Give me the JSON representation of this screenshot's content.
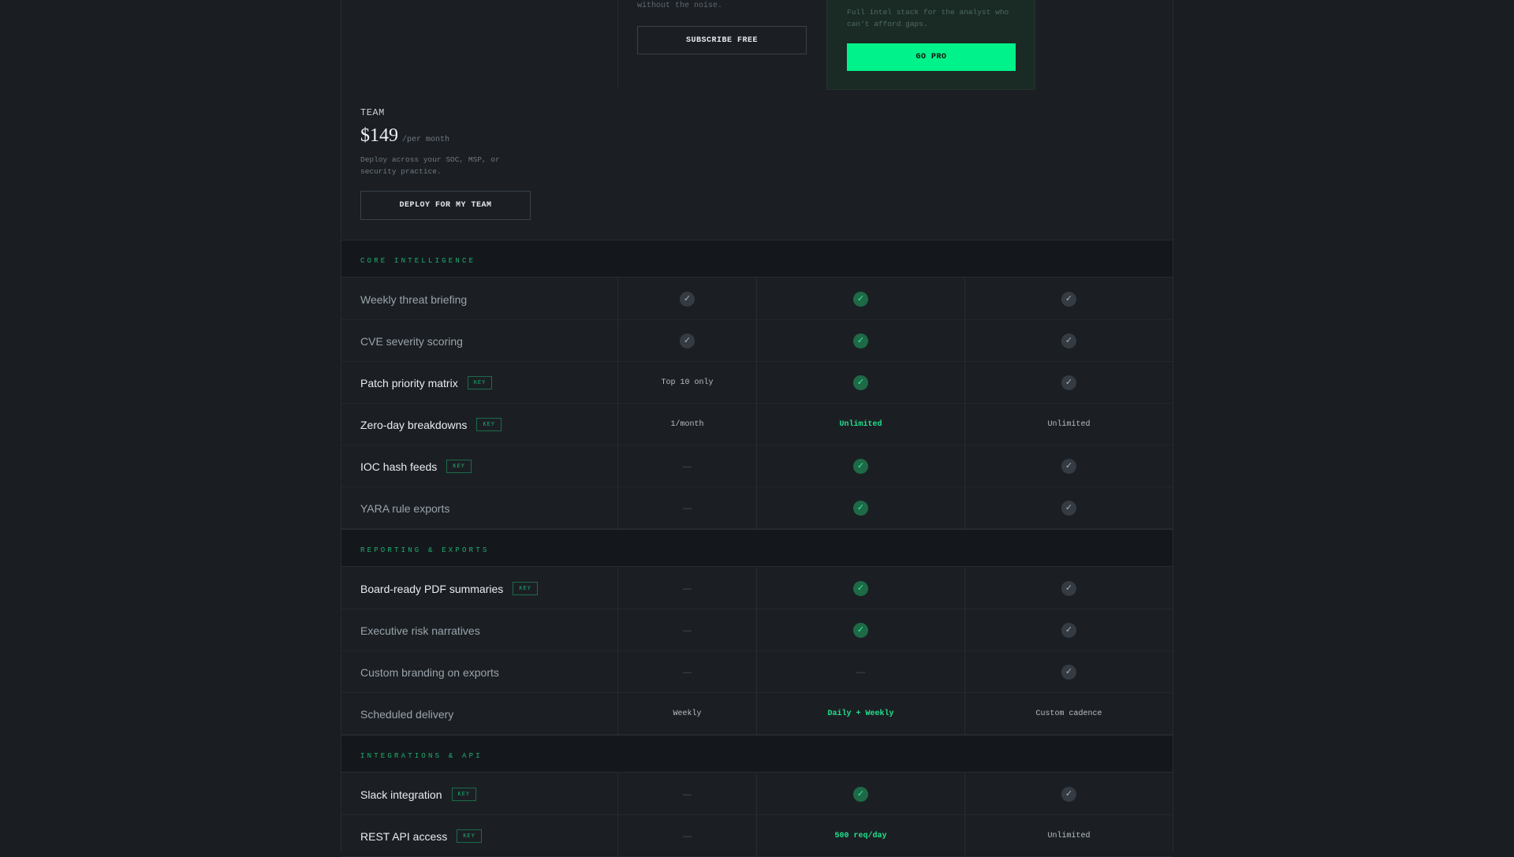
{
  "plans": {
    "free": {
      "desc_tail": "without the noise.",
      "button": "SUBSCRIBE FREE"
    },
    "pro": {
      "desc": "Full intel stack for the analyst who can't afford gaps.",
      "button": "GO PRO"
    },
    "team": {
      "name": "TEAM",
      "price": "$149",
      "period": "/per month",
      "desc": "Deploy across your SOC, MSP, or security practice.",
      "button": "DEPLOY FOR MY TEAM"
    }
  },
  "badge_label": "KEY",
  "sections": [
    {
      "title": "CORE INTELLIGENCE",
      "rows": [
        {
          "feature": "Weekly threat briefing",
          "key": false,
          "free": "check",
          "pro": "check",
          "team": "check"
        },
        {
          "feature": "CVE severity scoring",
          "key": false,
          "free": "check",
          "pro": "check",
          "team": "check"
        },
        {
          "feature": "Patch priority matrix",
          "key": true,
          "free": "Top 10 only",
          "pro": "check",
          "team": "check"
        },
        {
          "feature": "Zero-day breakdowns",
          "key": true,
          "free": "1/month",
          "pro": "Unlimited",
          "team": "Unlimited"
        },
        {
          "feature": "IOC hash feeds",
          "key": true,
          "free": "dash",
          "pro": "check",
          "team": "check"
        },
        {
          "feature": "YARA rule exports",
          "key": false,
          "free": "dash",
          "pro": "check",
          "team": "check"
        }
      ]
    },
    {
      "title": "REPORTING & EXPORTS",
      "rows": [
        {
          "feature": "Board-ready PDF summaries",
          "key": true,
          "free": "dash",
          "pro": "check",
          "team": "check"
        },
        {
          "feature": "Executive risk narratives",
          "key": false,
          "free": "dash",
          "pro": "check",
          "team": "check"
        },
        {
          "feature": "Custom branding on exports",
          "key": false,
          "free": "dash",
          "pro": "dash",
          "team": "check"
        },
        {
          "feature": "Scheduled delivery",
          "key": false,
          "free": "Weekly",
          "pro": "Daily + Weekly",
          "team": "Custom cadence"
        }
      ]
    },
    {
      "title": "INTEGRATIONS & API",
      "rows": [
        {
          "feature": "Slack integration",
          "key": true,
          "free": "dash",
          "pro": "check",
          "team": "check"
        },
        {
          "feature": "REST API access",
          "key": true,
          "free": "dash",
          "pro": "500 req/day",
          "team": "Unlimited"
        }
      ]
    }
  ],
  "icons": {
    "check": "check-icon",
    "dash": "dash-icon"
  },
  "colors": {
    "accent": "#00f28a",
    "accent_text": "#22e08d",
    "background": "#1a1e23"
  }
}
